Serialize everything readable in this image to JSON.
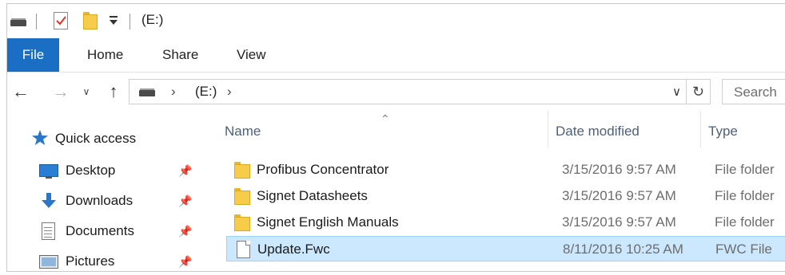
{
  "window": {
    "title": "(E:)"
  },
  "ribbon": {
    "tabs": [
      {
        "label": "File"
      },
      {
        "label": "Home"
      },
      {
        "label": "Share"
      },
      {
        "label": "View"
      }
    ],
    "accent": "#1a6fc4"
  },
  "address": {
    "segments": [
      "(E:)"
    ],
    "search_placeholder": "Search"
  },
  "navpane": {
    "quick_access": "Quick access",
    "items": [
      {
        "label": "Desktop",
        "icon": "desktop-icon",
        "pinned": true
      },
      {
        "label": "Downloads",
        "icon": "downloads-icon",
        "pinned": true
      },
      {
        "label": "Documents",
        "icon": "documents-icon",
        "pinned": true
      },
      {
        "label": "Pictures",
        "icon": "pictures-icon",
        "pinned": true
      }
    ]
  },
  "filelist": {
    "columns": {
      "name": "Name",
      "date": "Date modified",
      "type": "Type"
    },
    "rows": [
      {
        "name": "Profibus Concentrator",
        "date": "3/15/2016 9:57 AM",
        "type": "File folder",
        "icon": "folder-icon",
        "selected": false
      },
      {
        "name": "Signet Datasheets",
        "date": "3/15/2016 9:57 AM",
        "type": "File folder",
        "icon": "folder-icon",
        "selected": false
      },
      {
        "name": "Signet English Manuals",
        "date": "3/15/2016 9:57 AM",
        "type": "File folder",
        "icon": "folder-icon",
        "selected": false
      },
      {
        "name": "Update.Fwc",
        "date": "8/11/2016 10:25 AM",
        "type": "FWC File",
        "icon": "file-icon",
        "selected": true
      }
    ],
    "selection_color": "#cce8ff"
  }
}
